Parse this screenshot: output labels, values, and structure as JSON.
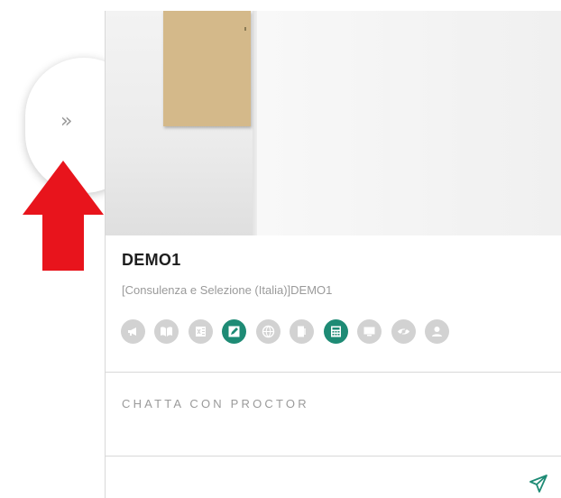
{
  "sidebar_toggle": {
    "icon": "double-chevron-right-icon",
    "label": "»"
  },
  "annotation": {
    "icon": "red-arrow-up-icon",
    "color": "#e8141c"
  },
  "proctor_panel": {
    "user_name": "DEMO1",
    "user_subtitle": "[Consulenza e Selezione (Italia)]DEMO1",
    "status_icons": [
      {
        "name": "megaphone-icon",
        "active": false
      },
      {
        "name": "book-icon",
        "active": false
      },
      {
        "name": "spreadsheet-icon",
        "active": false
      },
      {
        "name": "edit-icon",
        "active": true
      },
      {
        "name": "globe-icon",
        "active": false
      },
      {
        "name": "door-icon",
        "active": false
      },
      {
        "name": "calculator-icon",
        "active": true
      },
      {
        "name": "screen-icon",
        "active": false
      },
      {
        "name": "eye-off-icon",
        "active": false
      },
      {
        "name": "person-icon",
        "active": false
      }
    ],
    "active_color": "#1e8b75",
    "inactive_color": "#d2d2d2",
    "chat_placeholder": "CHATTA CON PROCTOR",
    "send_icon": "send-icon"
  }
}
